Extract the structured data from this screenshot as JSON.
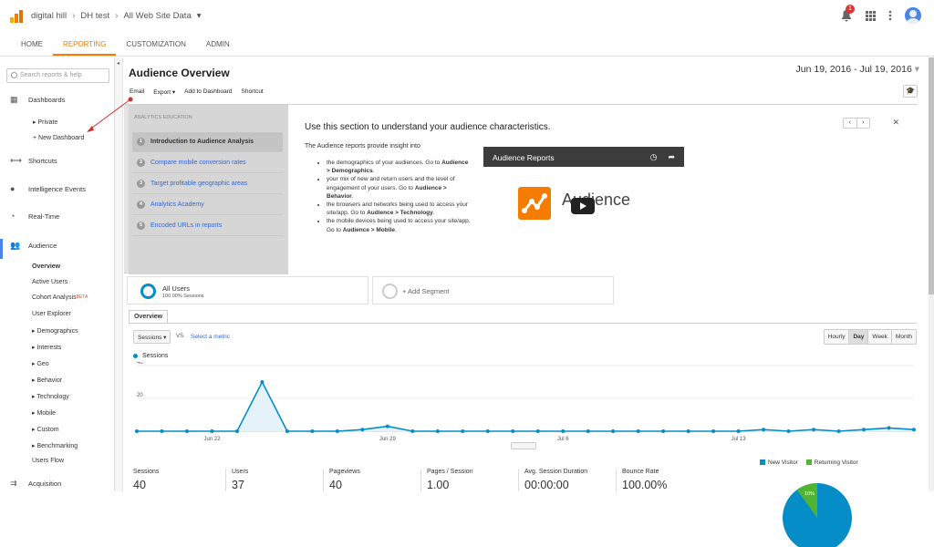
{
  "header": {
    "account": "digital hill",
    "property": "DH test",
    "view": "All Web Site Data",
    "notification_count": "1",
    "icons": {
      "logo": "analytics-logo",
      "bell": "bell-icon",
      "apps": "apps-grid-icon",
      "more": "more-vert-icon",
      "avatar": "avatar"
    }
  },
  "tabs": [
    {
      "label": "HOME"
    },
    {
      "label": "REPORTING",
      "active": true
    },
    {
      "label": "CUSTOMIZATION"
    },
    {
      "label": "ADMIN"
    }
  ],
  "sidebar": {
    "search_placeholder": "Search reports & help",
    "dashboards": {
      "label": "Dashboards",
      "private": "▸ Private",
      "new": "+ New Dashboard"
    },
    "shortcuts": "Shortcuts",
    "intelligence": "Intelligence Events",
    "realtime": "Real-Time",
    "audience": {
      "label": "Audience",
      "items": [
        "Overview",
        "Active Users",
        "Cohort Analysis",
        "User Explorer",
        "▸ Demographics",
        "▸ Interests",
        "▸ Geo",
        "▸ Behavior",
        "▸ Technology",
        "▸ Mobile",
        "▸ Custom",
        "▸ Benchmarking",
        "Users Flow"
      ],
      "beta": "BETA"
    },
    "acquisition": "Acquisition"
  },
  "report": {
    "title": "Audience Overview",
    "date_range": "Jun 19, 2016 - Jul 19, 2016",
    "actions": [
      "Email",
      "Export ▾",
      "Add to Dashboard",
      "Shortcut"
    ]
  },
  "education": {
    "header": "ANALYTICS EDUCATION",
    "steps": [
      {
        "num": "1",
        "label": "Introduction to Audience Analysis"
      },
      {
        "num": "2",
        "label": "Compare mobile conversion rates"
      },
      {
        "num": "3",
        "label": "Target profitable geographic areas"
      },
      {
        "num": "4",
        "label": "Analytics Academy"
      },
      {
        "num": "5",
        "label": "Encoded URLs in reports"
      }
    ],
    "title": "Use this section to understand your audience characteristics.",
    "intro": "The Audience reports provide insight into",
    "bullets": [
      {
        "pre": "the demographics of your audiences. Go to ",
        "bold": "Audience > Demographics",
        "post": "."
      },
      {
        "pre": "your mix of new and return users and the level of engagement of your users. Go to ",
        "bold": "Audience > Behavior",
        "post": "."
      },
      {
        "pre": "the browsers and networks being used to access your site/app. Go to ",
        "bold": "Audience > Technology",
        "post": "."
      },
      {
        "pre": "the mobile devices being used to access your site/app. Go to ",
        "bold": "Audience > Mobile",
        "post": "."
      }
    ],
    "video_title": "Audience Reports",
    "video_word": "Audience",
    "pager": [
      "‹",
      "›"
    ],
    "close": "✕"
  },
  "segments": {
    "all_users": "All Users",
    "all_users_pct": "100.00% Sessions",
    "add": "+ Add Segment"
  },
  "chart_controls": {
    "overview_tab": "Overview",
    "metric": "Sessions ▾",
    "vs": "VS.",
    "select_metric": "Select a metric",
    "granularity": [
      "Hourly",
      "Day",
      "Week",
      "Month"
    ],
    "active_granularity": "Day"
  },
  "chart_data": {
    "type": "area",
    "series": [
      {
        "name": "Sessions",
        "values": [
          0,
          0,
          0,
          0,
          0,
          30,
          0,
          0,
          0,
          1,
          3,
          0,
          0,
          0,
          0,
          0,
          0,
          0,
          0,
          0,
          0,
          0,
          0,
          0,
          0,
          1,
          0,
          1,
          0,
          1,
          2,
          1
        ]
      }
    ],
    "x_tick_labels": [
      {
        "index": 3,
        "label": "Jun 22"
      },
      {
        "index": 10,
        "label": "Jun 29"
      },
      {
        "index": 17,
        "label": "Jul 6"
      },
      {
        "index": 24,
        "label": "Jul 13"
      }
    ],
    "y_tick_labels": [
      {
        "value": 20,
        "label": "20"
      },
      {
        "value": 40,
        "label": "40"
      }
    ],
    "ylim": [
      0,
      40
    ],
    "color": "#058dc7"
  },
  "metrics": [
    {
      "label": "Sessions",
      "value": "40"
    },
    {
      "label": "Users",
      "value": "37"
    },
    {
      "label": "Pageviews",
      "value": "40"
    },
    {
      "label": "Pages / Session",
      "value": "1.00"
    },
    {
      "label": "Avg. Session Duration",
      "value": "00:00:00"
    },
    {
      "label": "Bounce Rate",
      "value": "100.00%"
    }
  ],
  "pie": {
    "new_visitor": "New Visitor",
    "returning_visitor": "Returning Visitor",
    "new_color": "#058dc7",
    "returning_color": "#50b432",
    "returning_pct_label": "10%",
    "returning_fraction": 0.1
  }
}
